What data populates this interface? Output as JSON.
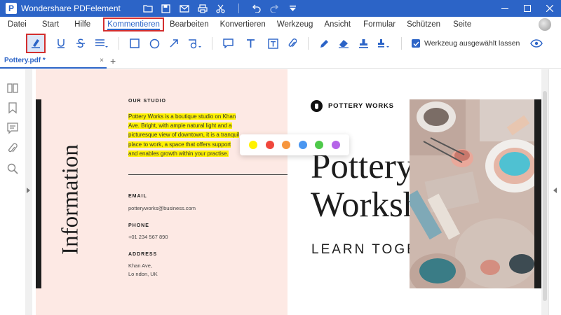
{
  "window": {
    "title": "Wondershare PDFelement",
    "logo_letter": "P",
    "quick_access_icons": [
      "folder-icon",
      "save-icon",
      "mail-icon",
      "print-icon",
      "cut-icon",
      "undo-icon",
      "redo-icon",
      "customize-icon"
    ],
    "controls": [
      "minimize-icon",
      "maximize-icon",
      "close-icon"
    ]
  },
  "menu": {
    "items": [
      "Datei",
      "Start",
      "Hilfe",
      "Kommentieren",
      "Bearbeiten",
      "Konvertieren",
      "Werkzeug",
      "Ansicht",
      "Formular",
      "Schützen",
      "Seite"
    ],
    "active": "Kommentieren"
  },
  "toolbar": {
    "tools": [
      "highlight-icon",
      "underline-icon",
      "strikethrough-icon",
      "text-lines-icon",
      "rectangle-icon",
      "circle-icon",
      "arrow-icon",
      "shapes-icon",
      "sticky-note-icon",
      "text-box-icon",
      "text-field-icon",
      "attachment-icon",
      "pencil-icon",
      "eraser-icon",
      "stamp-icon",
      "signature-icon",
      "eye-icon"
    ],
    "keep_tool_label": "Werkzeug ausgewählt lassen",
    "keep_tool_checked": true
  },
  "tabs": {
    "document": "Pottery.pdf *",
    "close": "×",
    "add": "+"
  },
  "sidebar": {
    "icons": [
      "thumbnails-icon",
      "bookmark-icon",
      "comments-icon",
      "attachments-icon",
      "search-icon"
    ]
  },
  "page": {
    "vertical_title": "Information",
    "studio_heading": "OUR STUDIO",
    "studio_text": "Pottery Works is a boutique studio on Khan Ave. Bright, with ample natural light and a picturesque view of downtown, it is a tranquil place to work, a space that offers support and enables growth within your practise.",
    "email_heading": "EMAIL",
    "email": "potteryworks@business.com",
    "phone_heading": "PHONE",
    "phone": "+01 234 567 890",
    "address_heading": "ADDRESS",
    "address_line1": "Khan Ave,",
    "address_line2": "Lo ndon, UK",
    "brand": "POTTERY WORKS",
    "title_line1": "Pottery",
    "title_line2": "Workshops",
    "subtitle": "LEARN TOGETHER"
  },
  "highlight_colors": [
    "#fff200",
    "#f0473c",
    "#f7963d",
    "#4a96f0",
    "#4ec94a",
    "#b565e8"
  ],
  "accent": "#2c64c7"
}
